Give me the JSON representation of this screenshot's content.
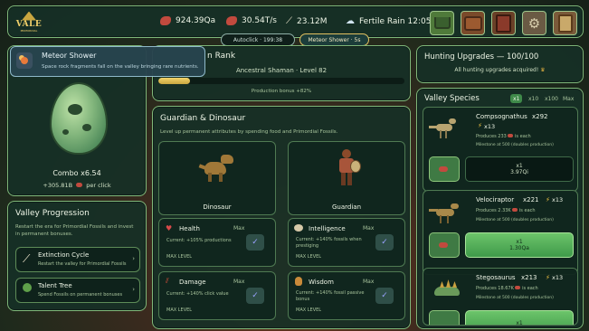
{
  "top": {
    "logo": "VALE",
    "logo_sub": "PRIMORDIAL",
    "meat": "924.39Qa",
    "meat_rate": "30.54T/s",
    "bones": "23.12M",
    "weather": "Fertile Rain 12:05",
    "autoclick": "Autoclick · 199:38",
    "meteor_chip": "Meteor Shower · 5s"
  },
  "meteor": {
    "title": "Meteor Shower",
    "desc": "Space rock fragments fall on the valley bringing rare nutrients."
  },
  "egg": {
    "combo": "Combo x6.54",
    "per_click_value": "+305.81B",
    "per_click_label": "per click"
  },
  "progression": {
    "title": "Valley Progression",
    "desc": "Restart the era for Primordial Fossils and invest in permanent bonuses.",
    "items": [
      {
        "label": "Extinction Cycle",
        "desc": "Restart the valley for Primordial Fossils",
        "icon": "bone-icon"
      },
      {
        "label": "Talent Tree",
        "desc": "Spend Fossils on permanent bonuses",
        "icon": "tree-icon"
      }
    ]
  },
  "rank": {
    "title_partial": "n Rank",
    "title_hidden": "Guardian",
    "subtitle": "Ancestral Shaman · Level 82",
    "bonus": "Production bonus +82%",
    "progress": 0.13
  },
  "guardian": {
    "title": "Guardian & Dinosaur",
    "desc": "Level up permanent attributes by spending food and Primordial Fossils.",
    "dino_label": "Dinosaur",
    "guardian_label": "Guardian",
    "stats": [
      {
        "name": "Health",
        "right": "Max",
        "desc": "Current: +105% productions",
        "level": "MAX LEVEL"
      },
      {
        "name": "Intelligence",
        "right": "Max",
        "desc": "Current: +140% fossils when prestiging",
        "level": "MAX LEVEL"
      },
      {
        "name": "Damage",
        "right": "Max",
        "desc": "Current: +140% click value",
        "level": "MAX LEVEL"
      },
      {
        "name": "Wisdom",
        "right": "Max",
        "desc": "Current: +140% fossil passive bonus",
        "level": "MAX LEVEL"
      }
    ]
  },
  "hunting": {
    "title": "Hunting Upgrades — 100/100",
    "subtitle": "All hunting upgrades acquired!"
  },
  "species": {
    "title": "Valley Species",
    "multipliers": [
      "x1",
      "x10",
      "x100",
      "Max"
    ],
    "list": [
      {
        "name": "Compsognathus",
        "count": "x292",
        "bonus": "x13",
        "produces": "Produces 233",
        "produces_suffix": "is each",
        "milestone": "Milestone at 500 (doubles production)",
        "buy_qty": "x1",
        "buy_cost": "3.97Qi"
      },
      {
        "name": "Velociraptor",
        "count": "x221",
        "bonus": "x13",
        "produces": "Produces 2.33K",
        "produces_suffix": "is each",
        "milestone": "Milestone at 500 (doubles production)",
        "buy_qty": "x1",
        "buy_cost": "1.30Qa"
      },
      {
        "name": "Stegosaurus",
        "count": "x213",
        "bonus": "x13",
        "produces": "Produces 18.67K",
        "produces_suffix": "is each",
        "milestone": "Milestone at 500 (doubles production)",
        "buy_qty": "x1",
        "buy_cost": ""
      }
    ]
  }
}
